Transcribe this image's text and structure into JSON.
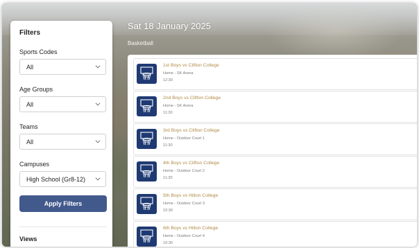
{
  "filters": {
    "title": "Filters",
    "sports_codes": {
      "label": "Sports Codes",
      "value": "All"
    },
    "age_groups": {
      "label": "Age Groups",
      "value": "All"
    },
    "teams": {
      "label": "Teams",
      "value": "All"
    },
    "campuses": {
      "label": "Campuses",
      "value": "High School (Gr8-12)"
    },
    "apply_button": "Apply Filters",
    "views_label": "Views"
  },
  "main": {
    "date": "Sat 18 January 2025",
    "sport": "Basketball",
    "fixtures": [
      {
        "title": "1st Boys vs Clifton College",
        "venue": "Home - SK Arena",
        "time": "12:30",
        "icon": "basketball-hoop-icon"
      },
      {
        "title": "2nd Boys vs Clifton College",
        "venue": "Home - SK Arena",
        "time": "11:30",
        "icon": "basketball-hoop-icon"
      },
      {
        "title": "3rd Boys vs Clifton College",
        "venue": "Home - Outdoor Court 1",
        "time": "11:30",
        "icon": "basketball-hoop-icon"
      },
      {
        "title": "4th Boys vs Clifton College",
        "venue": "Home - Outdoor Court 2",
        "time": "11:30",
        "icon": "basketball-hoop-icon"
      },
      {
        "title": "5th Boys vs Hilton College",
        "venue": "Home - Outdoor Court 3",
        "time": "10:30",
        "icon": "basketball-hoop-icon"
      },
      {
        "title": "6th Boys vs Hilton College",
        "venue": "Home - Outdoor Court 4",
        "time": "10:30",
        "icon": "basketball-hoop-icon"
      }
    ]
  },
  "colors": {
    "accent": "#42598c",
    "icon_bg": "#1f3a73",
    "fixture_title": "#b08a45"
  }
}
